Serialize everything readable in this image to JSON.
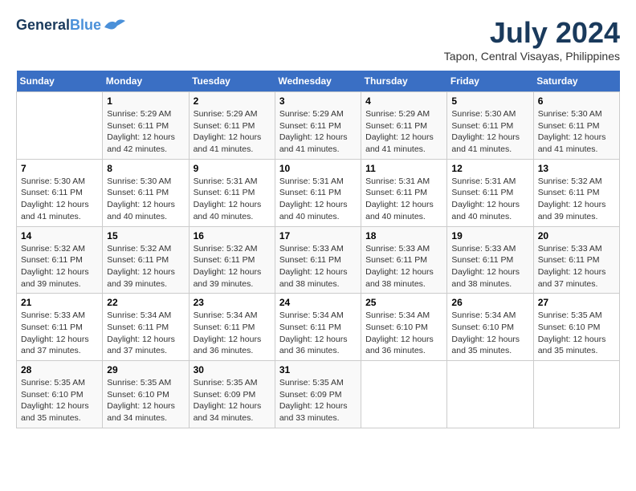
{
  "header": {
    "logo_line1": "General",
    "logo_line2": "Blue",
    "title": "July 2024",
    "subtitle": "Tapon, Central Visayas, Philippines"
  },
  "days_of_week": [
    "Sunday",
    "Monday",
    "Tuesday",
    "Wednesday",
    "Thursday",
    "Friday",
    "Saturday"
  ],
  "weeks": [
    [
      {
        "day": "",
        "info": ""
      },
      {
        "day": "1",
        "info": "Sunrise: 5:29 AM\nSunset: 6:11 PM\nDaylight: 12 hours\nand 42 minutes."
      },
      {
        "day": "2",
        "info": "Sunrise: 5:29 AM\nSunset: 6:11 PM\nDaylight: 12 hours\nand 41 minutes."
      },
      {
        "day": "3",
        "info": "Sunrise: 5:29 AM\nSunset: 6:11 PM\nDaylight: 12 hours\nand 41 minutes."
      },
      {
        "day": "4",
        "info": "Sunrise: 5:29 AM\nSunset: 6:11 PM\nDaylight: 12 hours\nand 41 minutes."
      },
      {
        "day": "5",
        "info": "Sunrise: 5:30 AM\nSunset: 6:11 PM\nDaylight: 12 hours\nand 41 minutes."
      },
      {
        "day": "6",
        "info": "Sunrise: 5:30 AM\nSunset: 6:11 PM\nDaylight: 12 hours\nand 41 minutes."
      }
    ],
    [
      {
        "day": "7",
        "info": "Sunrise: 5:30 AM\nSunset: 6:11 PM\nDaylight: 12 hours\nand 41 minutes."
      },
      {
        "day": "8",
        "info": "Sunrise: 5:30 AM\nSunset: 6:11 PM\nDaylight: 12 hours\nand 40 minutes."
      },
      {
        "day": "9",
        "info": "Sunrise: 5:31 AM\nSunset: 6:11 PM\nDaylight: 12 hours\nand 40 minutes."
      },
      {
        "day": "10",
        "info": "Sunrise: 5:31 AM\nSunset: 6:11 PM\nDaylight: 12 hours\nand 40 minutes."
      },
      {
        "day": "11",
        "info": "Sunrise: 5:31 AM\nSunset: 6:11 PM\nDaylight: 12 hours\nand 40 minutes."
      },
      {
        "day": "12",
        "info": "Sunrise: 5:31 AM\nSunset: 6:11 PM\nDaylight: 12 hours\nand 40 minutes."
      },
      {
        "day": "13",
        "info": "Sunrise: 5:32 AM\nSunset: 6:11 PM\nDaylight: 12 hours\nand 39 minutes."
      }
    ],
    [
      {
        "day": "14",
        "info": "Sunrise: 5:32 AM\nSunset: 6:11 PM\nDaylight: 12 hours\nand 39 minutes."
      },
      {
        "day": "15",
        "info": "Sunrise: 5:32 AM\nSunset: 6:11 PM\nDaylight: 12 hours\nand 39 minutes."
      },
      {
        "day": "16",
        "info": "Sunrise: 5:32 AM\nSunset: 6:11 PM\nDaylight: 12 hours\nand 39 minutes."
      },
      {
        "day": "17",
        "info": "Sunrise: 5:33 AM\nSunset: 6:11 PM\nDaylight: 12 hours\nand 38 minutes."
      },
      {
        "day": "18",
        "info": "Sunrise: 5:33 AM\nSunset: 6:11 PM\nDaylight: 12 hours\nand 38 minutes."
      },
      {
        "day": "19",
        "info": "Sunrise: 5:33 AM\nSunset: 6:11 PM\nDaylight: 12 hours\nand 38 minutes."
      },
      {
        "day": "20",
        "info": "Sunrise: 5:33 AM\nSunset: 6:11 PM\nDaylight: 12 hours\nand 37 minutes."
      }
    ],
    [
      {
        "day": "21",
        "info": "Sunrise: 5:33 AM\nSunset: 6:11 PM\nDaylight: 12 hours\nand 37 minutes."
      },
      {
        "day": "22",
        "info": "Sunrise: 5:34 AM\nSunset: 6:11 PM\nDaylight: 12 hours\nand 37 minutes."
      },
      {
        "day": "23",
        "info": "Sunrise: 5:34 AM\nSunset: 6:11 PM\nDaylight: 12 hours\nand 36 minutes."
      },
      {
        "day": "24",
        "info": "Sunrise: 5:34 AM\nSunset: 6:11 PM\nDaylight: 12 hours\nand 36 minutes."
      },
      {
        "day": "25",
        "info": "Sunrise: 5:34 AM\nSunset: 6:10 PM\nDaylight: 12 hours\nand 36 minutes."
      },
      {
        "day": "26",
        "info": "Sunrise: 5:34 AM\nSunset: 6:10 PM\nDaylight: 12 hours\nand 35 minutes."
      },
      {
        "day": "27",
        "info": "Sunrise: 5:35 AM\nSunset: 6:10 PM\nDaylight: 12 hours\nand 35 minutes."
      }
    ],
    [
      {
        "day": "28",
        "info": "Sunrise: 5:35 AM\nSunset: 6:10 PM\nDaylight: 12 hours\nand 35 minutes."
      },
      {
        "day": "29",
        "info": "Sunrise: 5:35 AM\nSunset: 6:10 PM\nDaylight: 12 hours\nand 34 minutes."
      },
      {
        "day": "30",
        "info": "Sunrise: 5:35 AM\nSunset: 6:09 PM\nDaylight: 12 hours\nand 34 minutes."
      },
      {
        "day": "31",
        "info": "Sunrise: 5:35 AM\nSunset: 6:09 PM\nDaylight: 12 hours\nand 33 minutes."
      },
      {
        "day": "",
        "info": ""
      },
      {
        "day": "",
        "info": ""
      },
      {
        "day": "",
        "info": ""
      }
    ]
  ]
}
